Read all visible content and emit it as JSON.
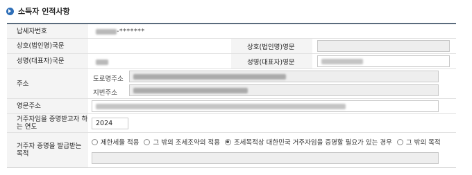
{
  "section": {
    "title": "소득자 인적사항"
  },
  "fields": {
    "tin": {
      "label": "납세자번호",
      "value_suffix": "-*******"
    },
    "name_kr": {
      "label": "상호(법인명)국문"
    },
    "name_en": {
      "label": "상호(법인명)영문"
    },
    "rep_kr": {
      "label": "성명(대표자)국문"
    },
    "rep_en": {
      "label": "성명(대표자)영문"
    },
    "address": {
      "label": "주소",
      "road_label": "도로명주소",
      "lot_label": "지번주소"
    },
    "address_en": {
      "label": "영문주소"
    },
    "year": {
      "label": "거주자임을 증명받고자 하는 연도",
      "value": "2024"
    },
    "purpose": {
      "label": "거주자 증명을 발급받는 목적",
      "options": [
        {
          "label": "제한세율 적용",
          "selected": false
        },
        {
          "label": "그 밖의 조세조약의 적용",
          "selected": false
        },
        {
          "label": "조세목적상 대한민국 거주자임을 증명할 필요가 있는 경우",
          "selected": true
        },
        {
          "label": "그 밖의 목적",
          "selected": false
        }
      ]
    }
  }
}
